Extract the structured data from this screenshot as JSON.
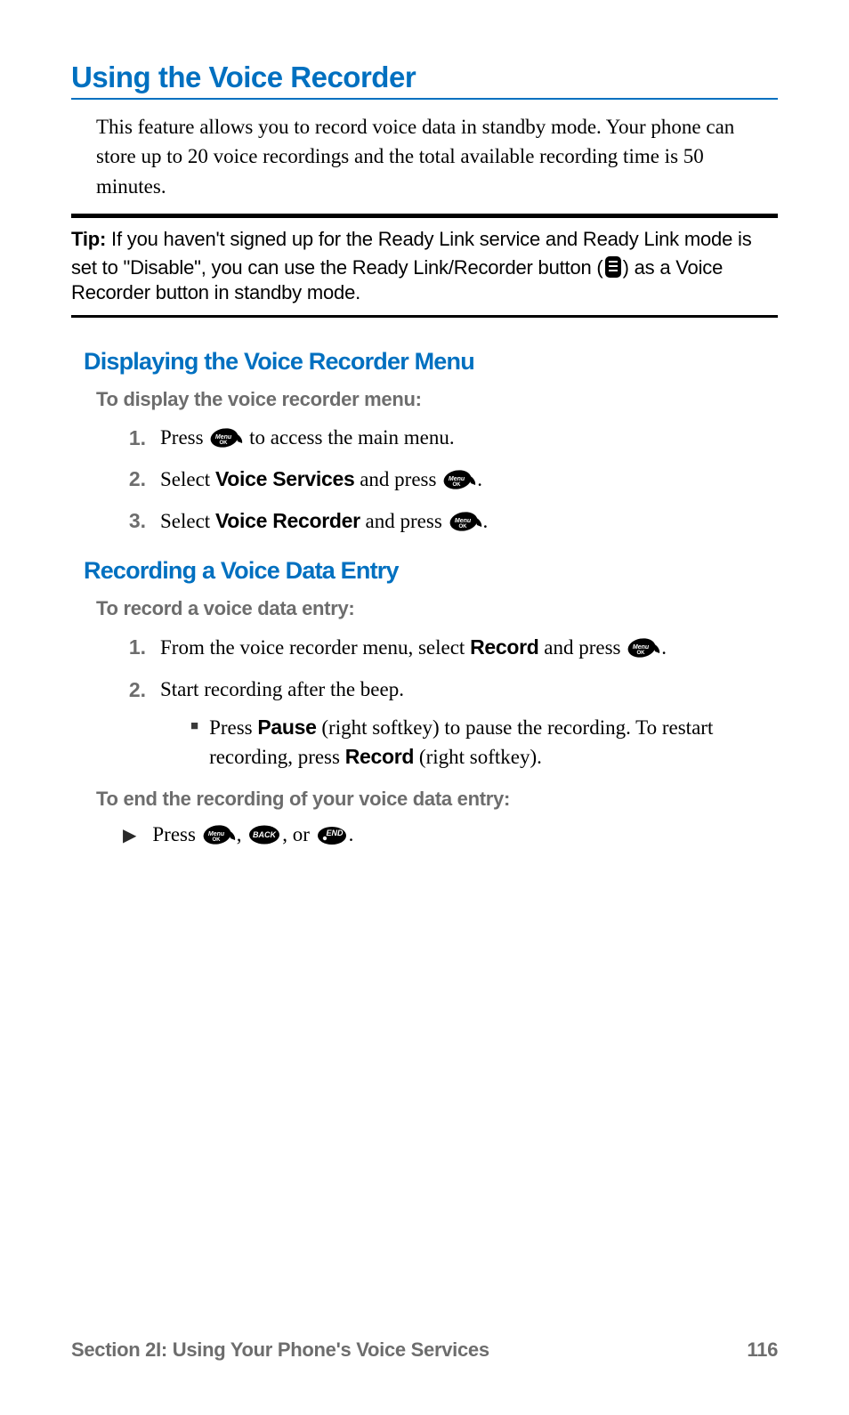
{
  "h1": "Using the Voice Recorder",
  "intro": "This feature allows you to record voice data in standby mode. Your phone can store up to 20 voice recordings and the total available recording time is 50 minutes.",
  "tip": {
    "label": "Tip:",
    "before_icon": " If you haven't signed up for the Ready Link service and Ready Link mode is set to \"Disable\", you can use the Ready Link/Recorder button (",
    "after_icon": ") as a Voice Recorder button in standby mode."
  },
  "sections": [
    {
      "title": "Displaying the Voice Recorder Menu",
      "lead": "To display the voice recorder menu:",
      "steps": [
        {
          "num": "1.",
          "pre": "Press ",
          "icon": "menu",
          "post": " to access the main menu."
        },
        {
          "num": "2.",
          "pre": "Select ",
          "b": "Voice Services",
          "mid": " and press ",
          "icon": "menu",
          "post": "."
        },
        {
          "num": "3.",
          "pre": "Select ",
          "b": "Voice Recorder",
          "mid": " and press ",
          "icon": "menu",
          "post": "."
        }
      ]
    },
    {
      "title": "Recording a Voice Data Entry",
      "lead": "To record a voice data entry:",
      "steps2": [
        {
          "num": "1.",
          "pre": "From the voice recorder menu, select ",
          "b": "Record",
          "mid": " and press ",
          "icon": "menu",
          "post": "."
        },
        {
          "num": "2.",
          "text": "Start recording after the beep.",
          "sub": {
            "pre": "Press ",
            "b1": "Pause",
            "mid1": " (right softkey) to pause the recording. To restart recording, press ",
            "b2": "Record",
            "mid2": " (right softkey)."
          }
        }
      ],
      "lead2": "To end the recording of your voice data entry:",
      "arrow": {
        "pre": "Press ",
        "sep1": ", ",
        "sep2": ", or ",
        "post": "."
      }
    }
  ],
  "footer": {
    "left": "Section 2I: Using Your Phone's Voice Services",
    "right": "116"
  }
}
